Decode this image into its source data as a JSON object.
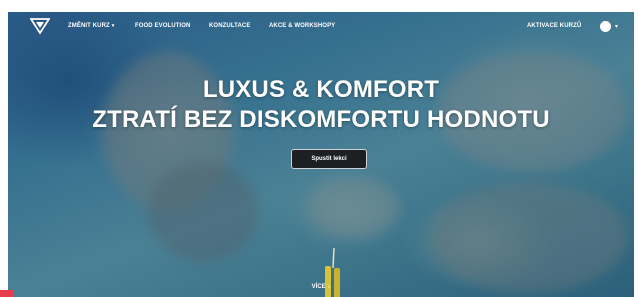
{
  "nav": {
    "items": [
      {
        "label": "ZMĚNIT KURZ",
        "has_caret": true
      },
      {
        "label": "FOOD EVOLUTION",
        "has_caret": false
      },
      {
        "label": "KONZULTACE",
        "has_caret": false
      },
      {
        "label": "AKCE & WORKSHOPY",
        "has_caret": false
      }
    ],
    "activation_label": "AKTIVACE KURZŮ",
    "caret_glyph": "▾"
  },
  "hero": {
    "headline_line1": "LUXUS & KOMFORT",
    "headline_line2": "ZTRATÍ BEZ DISKOMFORTU HODNOTU",
    "cta_label": "Spustit lekci",
    "more_label": "VÍCE ↓"
  },
  "colors": {
    "cta_bg": "#1d1f22",
    "text": "#ffffff",
    "accent_red": "#e63c4b"
  },
  "icons": [
    "logo-icon",
    "chevron-down-icon",
    "avatar-icon"
  ]
}
